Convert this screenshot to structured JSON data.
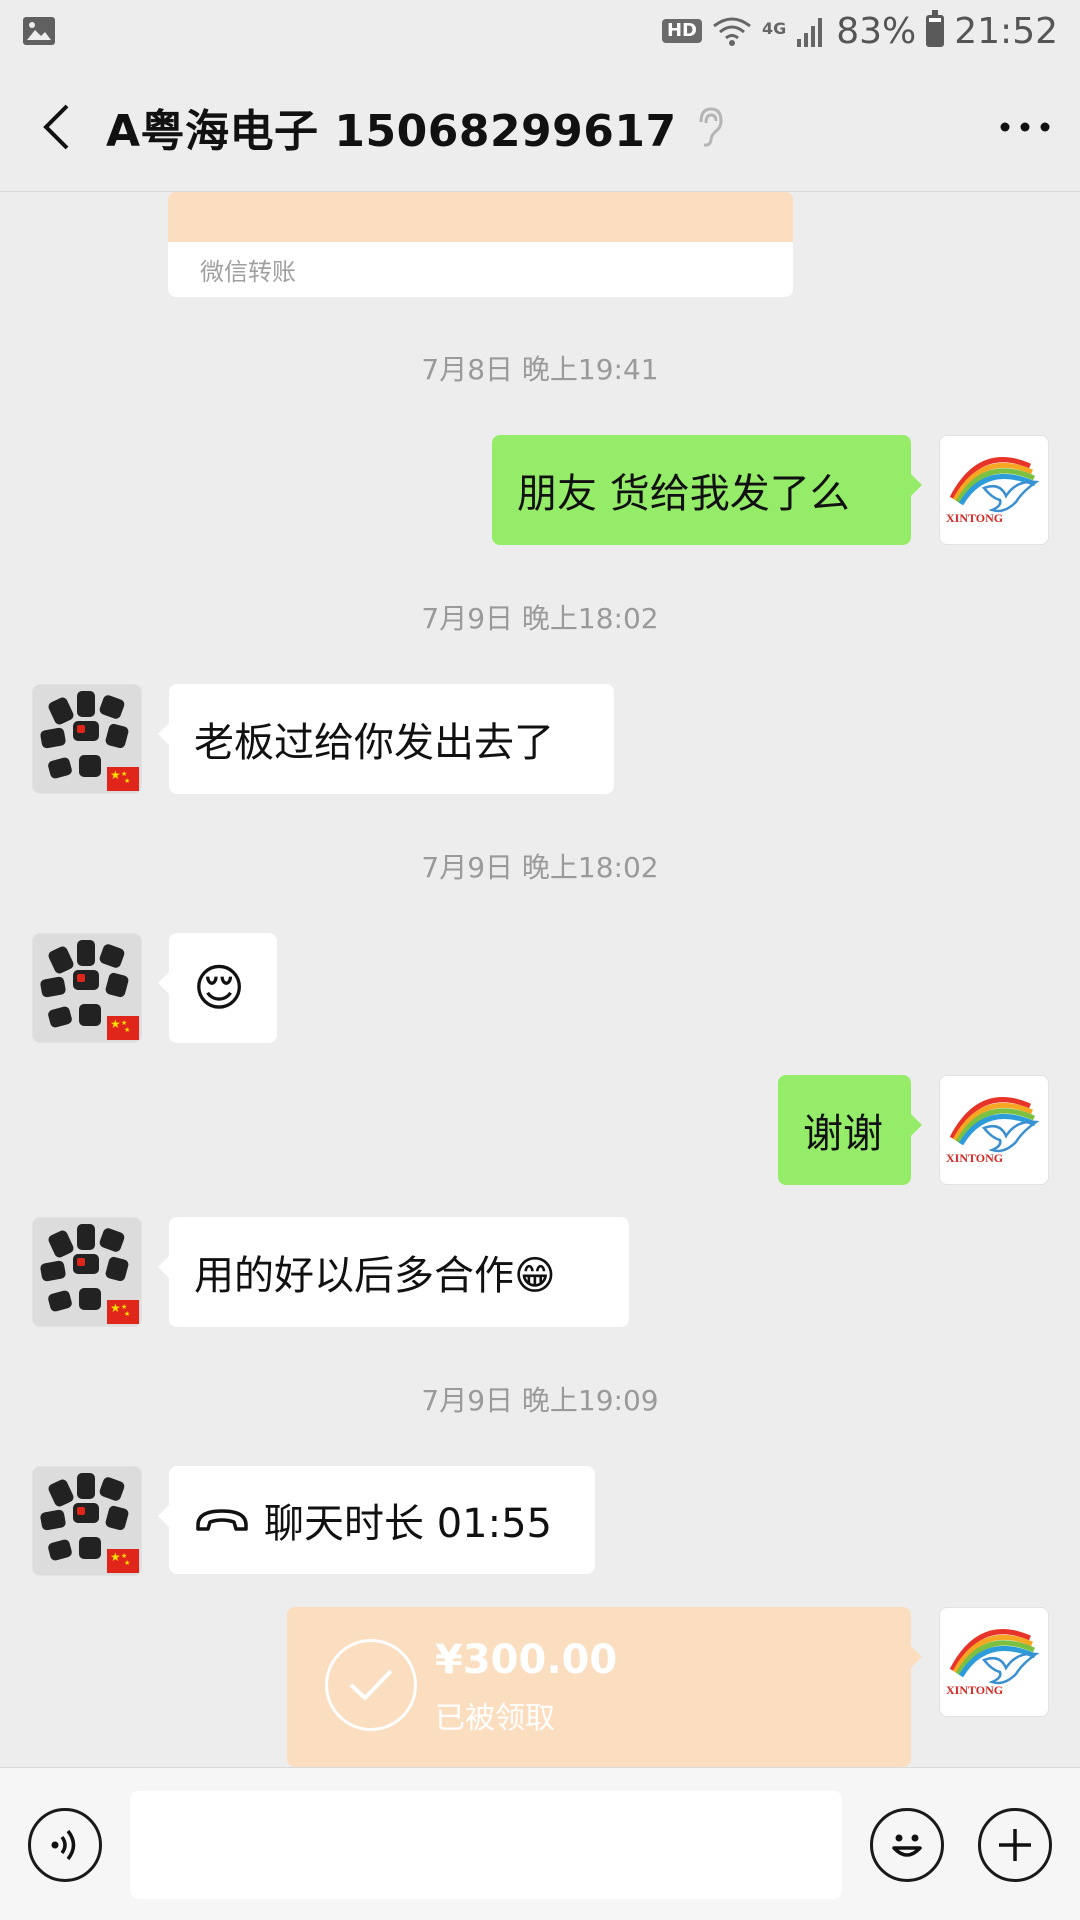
{
  "status_bar": {
    "hd": "HD",
    "network": "4G",
    "battery": "83%",
    "battery_level": 0.83,
    "time": "21:52"
  },
  "header": {
    "title": "A粤海电子 15068299617"
  },
  "chat": {
    "transfer_top": {
      "source_label": "微信转账"
    },
    "times": [
      "7月8日 晚上19:41",
      "7月9日 晚上18:02",
      "7月9日 晚上18:02",
      "7月9日 晚上19:09"
    ],
    "messages": {
      "m1": "朋友  货给我发了么",
      "m2": "老板过给你发出去了",
      "m3": "😌",
      "m4": "谢谢",
      "m5": "用的好以后多合作😁",
      "m6": "聊天时长 01:55"
    },
    "transfer_bottom": {
      "amount": "¥300.00",
      "status": "已被领取"
    },
    "my_avatar_text": "XINTONG"
  },
  "colors": {
    "background": "#ededed",
    "outgoing_bubble": "#95ec69",
    "incoming_bubble": "#ffffff",
    "transfer_card": "#fbdec0"
  }
}
